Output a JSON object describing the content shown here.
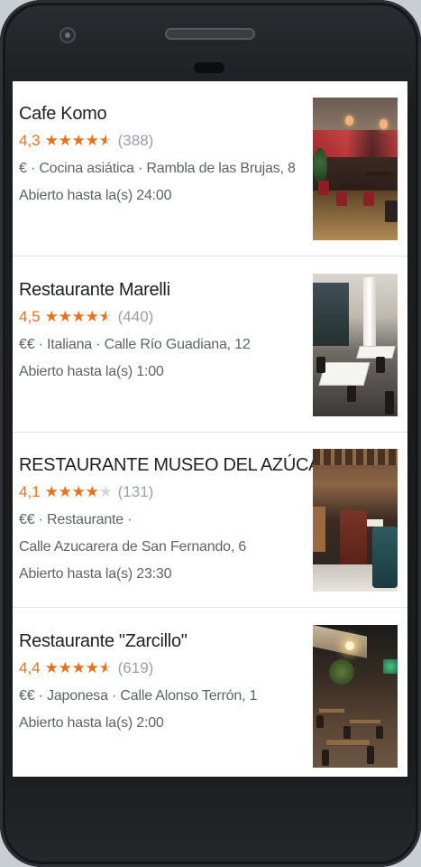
{
  "listings": [
    {
      "name": "Cafe Komo",
      "rating": "4,3",
      "stars": 4.3,
      "reviews": "(388)",
      "details": "€ · Cocina asiática · Rambla de las Brujas, 8",
      "address": "",
      "hours": "Abierto hasta la(s) 24:00",
      "photo_icon": "restaurant-photo"
    },
    {
      "name": "Restaurante Marelli",
      "rating": "4,5",
      "stars": 4.5,
      "reviews": "(440)",
      "details": "€€ · Italiana · Calle Río Guadiana, 12",
      "address": "",
      "hours": "Abierto hasta la(s) 1:00",
      "photo_icon": "restaurant-photo"
    },
    {
      "name": "RESTAURANTE MUSEO DEL AZÚCAR",
      "rating": "4,1",
      "stars": 4.1,
      "reviews": "(131)",
      "details": "€€ · Restaurante ·",
      "address": "Calle Azucarera de San Fernando, 6",
      "hours": "Abierto hasta la(s) 23:30",
      "photo_icon": "restaurant-photo"
    },
    {
      "name": "Restaurante \"Zarcillo\"",
      "rating": "4,4",
      "stars": 4.4,
      "reviews": "(619)",
      "details": "€€ · Japonesa · Calle Alonso Terrón, 1",
      "address": "",
      "hours": "Abierto hasta la(s) 2:00",
      "photo_icon": "restaurant-photo"
    }
  ],
  "colors": {
    "rating": "#e7711b",
    "star_empty": "#d6d6d6",
    "reviews": "#9aa0a6",
    "detail_text": "#5f6368",
    "title_text": "#202124"
  }
}
